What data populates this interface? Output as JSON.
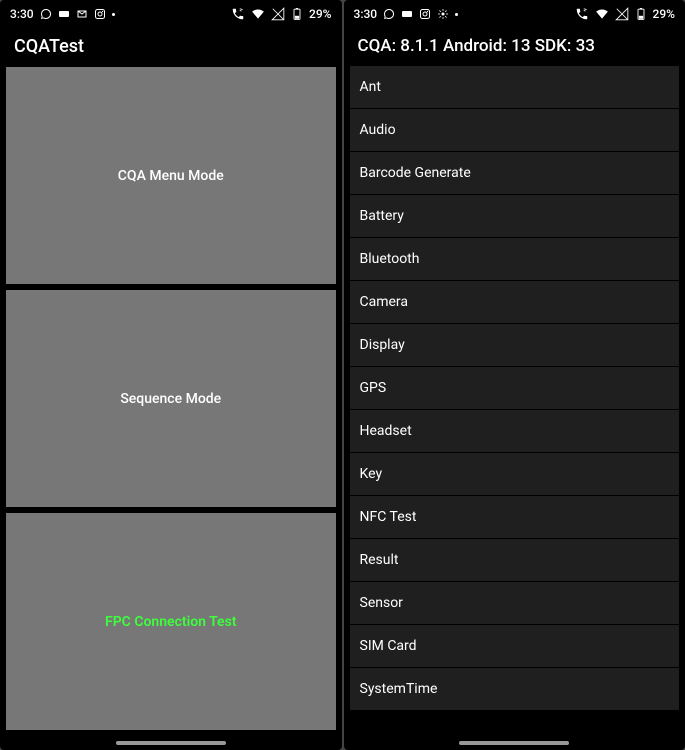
{
  "status": {
    "time": "3:30",
    "battery_pct": "29%"
  },
  "left": {
    "title": "CQATest",
    "tiles": [
      {
        "label": "CQA Menu Mode",
        "highlight": false
      },
      {
        "label": "Sequence Mode",
        "highlight": false
      },
      {
        "label": "FPC Connection Test",
        "highlight": true
      }
    ]
  },
  "right": {
    "title": "CQA: 8.1.1 Android: 13 SDK: 33",
    "items": [
      "Ant",
      "Audio",
      "Barcode Generate",
      "Battery",
      "Bluetooth",
      "Camera",
      "Display",
      "GPS",
      "Headset",
      "Key",
      "NFC Test",
      "Result",
      "Sensor",
      "SIM Card",
      "SystemTime"
    ]
  }
}
